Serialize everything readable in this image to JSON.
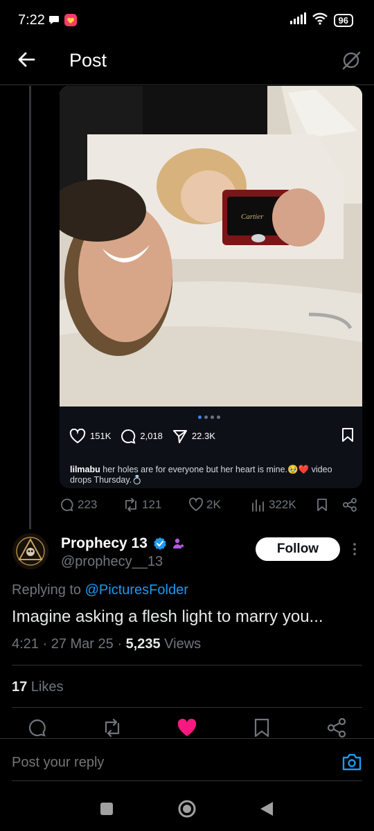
{
  "status_bar": {
    "time": "7:22",
    "battery": "96"
  },
  "header": {
    "title": "Post"
  },
  "embed": {
    "ig_likes": "151K",
    "ig_comments": "2,018",
    "ig_shares": "22.3K",
    "caption_user": "lilmabu",
    "caption_text": " her holes are for everyone but her heart is mine.🥹❤️ video drops Thursday.💍",
    "photo_box_text": "Cartier"
  },
  "quoted_metrics": {
    "replies": "223",
    "reposts": "121",
    "likes": "2K",
    "views": "322K"
  },
  "reply": {
    "display_name": "Prophecy 13",
    "handle": "@prophecy__13",
    "follow_label": "Follow",
    "replying_prefix": "Replying to ",
    "replying_to": "@PicturesFolder",
    "text": "Imagine asking a flesh light to marry you...",
    "time": "4:21",
    "date": "27 Mar 25",
    "views_count": "5,235",
    "views_label": " Views",
    "likes_count": "17",
    "likes_label": " Likes"
  },
  "composer": {
    "placeholder": "Post your reply"
  },
  "colors": {
    "accent": "#1d9bf0",
    "like": "#f91880",
    "verified": "#1d9bf0",
    "background": "#000000"
  }
}
